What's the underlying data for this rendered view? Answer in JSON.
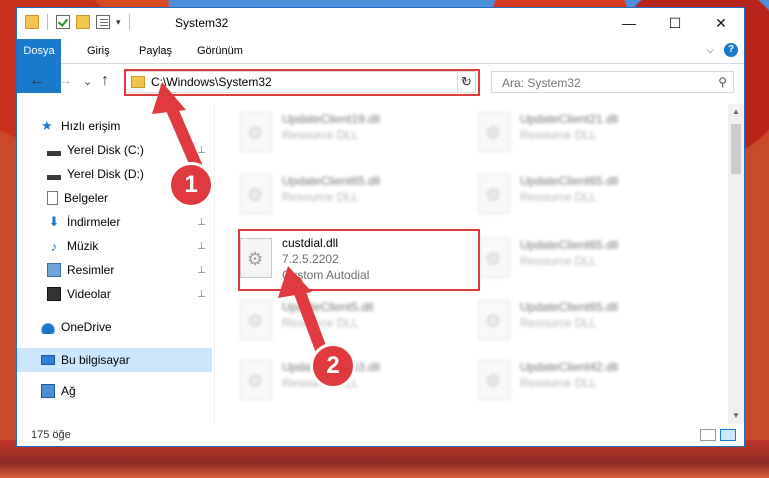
{
  "window": {
    "title": "System32",
    "controls": {
      "minimize": "—",
      "maximize": "☐",
      "close": "✕"
    }
  },
  "ribbon": {
    "tabs": [
      "Dosya",
      "Giriş",
      "Paylaş",
      "Görünüm"
    ],
    "expand_icon": "chevron-down-icon",
    "help_icon": "?"
  },
  "address": {
    "path": "C:\\Windows\\System32",
    "dropdown": "⌵",
    "refresh": "↻"
  },
  "search": {
    "placeholder": "Ara: System32",
    "icon": "⚲"
  },
  "nav": {
    "back": "←",
    "forward": "→",
    "recent": "⌄",
    "up": "↑",
    "items": [
      {
        "label": "Hızlı erişim",
        "icon": "star-icon"
      },
      {
        "label": "Yerel Disk (C:)",
        "icon": "drive-icon",
        "pinned": true
      },
      {
        "label": "Yerel Disk (D:)",
        "icon": "drive-icon",
        "pinned": true
      },
      {
        "label": "Belgeler",
        "icon": "document-icon",
        "pinned": true
      },
      {
        "label": "İndirmeler",
        "icon": "download-icon",
        "pinned": true
      },
      {
        "label": "Müzik",
        "icon": "music-icon",
        "pinned": true
      },
      {
        "label": "Resimler",
        "icon": "pictures-icon",
        "pinned": true
      },
      {
        "label": "Videolar",
        "icon": "videos-icon",
        "pinned": true
      },
      {
        "label": "OneDrive",
        "icon": "cloud-icon"
      },
      {
        "label": "Bu bilgisayar",
        "icon": "computer-icon",
        "selected": true
      },
      {
        "label": "Ağ",
        "icon": "network-icon"
      }
    ],
    "pin_glyph": "📌"
  },
  "files": [
    {
      "name": "UpdateClient19.dll",
      "sub": "Resource DLL",
      "blurred": true
    },
    {
      "name": "UpdateClient21.dll",
      "sub": "Resource DLL",
      "blurred": true
    },
    {
      "name": "UpdateClient65.dll",
      "sub": "Resource DLL",
      "blurred": true
    },
    {
      "name": "UpdateClient65.dll",
      "sub": "Resource DLL",
      "blurred": true
    },
    {
      "name": "custdial.dll",
      "version": "7.2.5.2202",
      "sub": "Custom Autodial",
      "blurred": false
    },
    {
      "name": "UpdateClient65.dll",
      "sub": "Resource DLL",
      "blurred": true
    },
    {
      "name": "UpdateClient5.dll",
      "sub": "Resource DLL",
      "blurred": true
    },
    {
      "name": "UpdateClient65.dll",
      "sub": "Resource DLL",
      "blurred": true
    },
    {
      "name": "UpdateClient63.dll",
      "sub": "Resource DLL",
      "blurred": true
    },
    {
      "name": "UpdateClient42.dll",
      "sub": "Resource DLL",
      "blurred": true
    }
  ],
  "status": {
    "count": "175 öğe"
  },
  "callouts": {
    "one": "1",
    "two": "2"
  },
  "colors": {
    "accent": "#1979ca",
    "highlight": "#e0393e"
  }
}
